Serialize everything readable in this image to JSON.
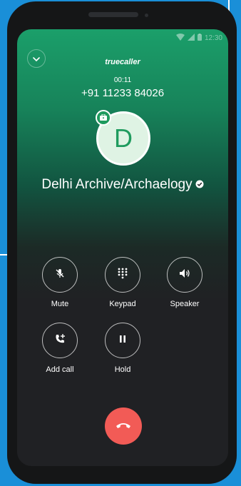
{
  "status_bar": {
    "time": "12:30",
    "icons": [
      "wifi-icon",
      "signal-icon",
      "battery-icon"
    ]
  },
  "header": {
    "collapse_icon": "chevron-down-icon",
    "brand": "truecaller"
  },
  "call": {
    "timer": "00:11",
    "number": "+91 11233 84026",
    "avatar_letter": "D",
    "badge_icon": "briefcase-icon",
    "caller_name": "Delhi Archive/Archaelogy",
    "verified_icon": "verified-check-icon"
  },
  "actions": [
    {
      "label": "Mute",
      "icon": "mic-off-icon"
    },
    {
      "label": "Keypad",
      "icon": "dialpad-icon"
    },
    {
      "label": "Speaker",
      "icon": "speaker-icon"
    },
    {
      "label": "Add call",
      "icon": "add-call-icon"
    },
    {
      "label": "Hold",
      "icon": "pause-icon"
    }
  ],
  "end_call": {
    "icon": "hang-up-icon",
    "color": "#f25b56"
  },
  "colors": {
    "background": "#1a8fd8",
    "gradient_top": "#1b9f6a",
    "screen_dark": "#202124",
    "avatar_fill": "#dff3e4",
    "avatar_letter": "#1f9b5e"
  }
}
